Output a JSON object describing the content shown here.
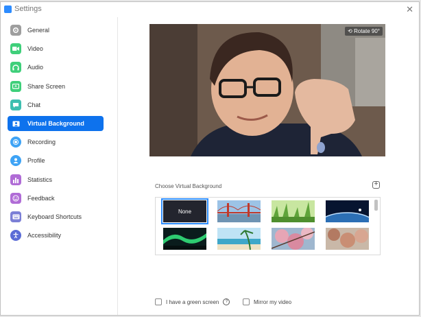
{
  "window": {
    "title": "Settings",
    "close_glyph": "✕"
  },
  "sidebar": {
    "items": [
      {
        "label": "General",
        "icon": "gear-icon",
        "color": "#9e9e9e"
      },
      {
        "label": "Video",
        "icon": "video-camera-icon",
        "color": "#3fcf7a"
      },
      {
        "label": "Audio",
        "icon": "headphones-icon",
        "color": "#3fcf7a"
      },
      {
        "label": "Share Screen",
        "icon": "share-screen-icon",
        "color": "#3fcf7a"
      },
      {
        "label": "Chat",
        "icon": "chat-bubble-icon",
        "color": "#3fbfb0"
      },
      {
        "label": "Virtual Background",
        "icon": "person-portrait-icon",
        "color": "#0e72ed",
        "active": true
      },
      {
        "label": "Recording",
        "icon": "record-icon",
        "color": "#3ea3f5"
      },
      {
        "label": "Profile",
        "icon": "user-icon",
        "color": "#3ea3f5"
      },
      {
        "label": "Statistics",
        "icon": "bar-chart-icon",
        "color": "#b06cd6"
      },
      {
        "label": "Feedback",
        "icon": "smiley-icon",
        "color": "#b06cd6"
      },
      {
        "label": "Keyboard Shortcuts",
        "icon": "keyboard-icon",
        "color": "#7b7fd6"
      },
      {
        "label": "Accessibility",
        "icon": "accessibility-icon",
        "color": "#5b6cd6"
      }
    ]
  },
  "preview": {
    "rotate_label": "Rotate 90°"
  },
  "backgrounds": {
    "title": "Choose Virtual Background",
    "none_label": "None",
    "items": [
      "none",
      "golden-gate-bridge",
      "grass",
      "earth-from-space",
      "aurora",
      "beach",
      "cherry-blossom-1",
      "cherry-blossom-2"
    ]
  },
  "options": {
    "green_screen_label": "I have a green screen",
    "mirror_label": "Mirror my video"
  },
  "colors": {
    "accent": "#0e72ed"
  }
}
